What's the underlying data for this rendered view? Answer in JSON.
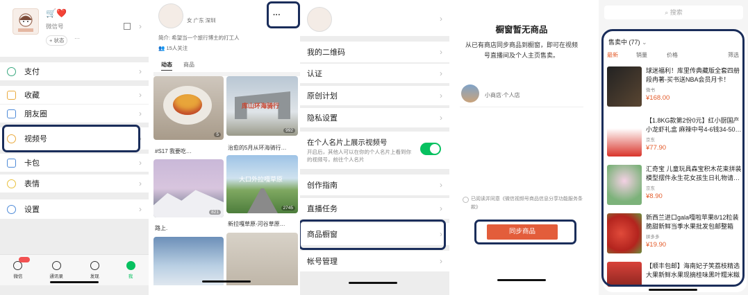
{
  "p1": {
    "nickname": "🛒❤️",
    "wechat_id": "微信号",
    "status": "+ 状态",
    "status_more": "···",
    "menu": [
      {
        "label": "支付"
      },
      {
        "label": "收藏"
      },
      {
        "label": "朋友圈"
      },
      {
        "label": "视频号"
      },
      {
        "label": "卡包"
      },
      {
        "label": "表情"
      },
      {
        "label": "设置"
      }
    ],
    "tabs": [
      "微信",
      "通讯录",
      "发现",
      "我"
    ]
  },
  "p2": {
    "more": "···",
    "profile_meta": "女 广东 深圳",
    "bio": "简介: 希望当一个旅行博主的打工人",
    "followers": "15人关注",
    "tabs": [
      "动态",
      "商品"
    ],
    "posts": [
      {
        "caption": "#S17 我要吃…",
        "views": "5"
      },
      {
        "caption": "治愈的5月从环海骑行…",
        "views": "992"
      },
      {
        "caption": "路上.",
        "views": "821"
      },
      {
        "caption": "新拉嘎草原-河谷草原…",
        "views": "2745"
      }
    ],
    "arch_text": "库山环海骑行",
    "road_text": "大口外拉嘎草原"
  },
  "p3": {
    "items": [
      {
        "label": "我的二维码"
      },
      {
        "label": "认证"
      },
      {
        "label": "原创计划"
      },
      {
        "label": "隐私设置"
      }
    ],
    "toggle_label": "在个人名片上展示视频号",
    "toggle_desc": "开启后，其他人可以在你的个人名片上看到你的视频号，前往个人名片",
    "items2": [
      {
        "label": "创作指南"
      },
      {
        "label": "直播任务"
      },
      {
        "label": "商品橱窗"
      },
      {
        "label": "帐号管理"
      }
    ]
  },
  "p4": {
    "title": "橱窗暂无商品",
    "desc": "从已有商店同步商品到橱窗，即可在视频号直播间及个人主页售卖。",
    "shop": "小商店·个人店",
    "agree": "已阅读并同意《微信视频号商品信息分享功能服务条款》",
    "sync_button": "同步商品"
  },
  "p5": {
    "search_placeholder": "搜索",
    "filter": "售卖中 (77)",
    "sorts": [
      "最新",
      "销量",
      "价格",
      "筛选"
    ],
    "products": [
      {
        "title": "球迷福利！库里传典藏版全套四册 段冉著-买书送NBA会员月卡！",
        "shop": "微书",
        "price": "¥168.00"
      },
      {
        "title": "【1.8KG款第2份0元】红小厨国产小龙虾礼盒 麻辣中号4-6钱34-50…",
        "shop": "京东",
        "price": "¥77.90"
      },
      {
        "title": "汇奇宝 儿童玩具森宝积木花束拼装模型摆件永生花女孩生日礼物请…",
        "shop": "京东",
        "price": "¥8.90"
      },
      {
        "title": "新西兰进口gala嘎啦苹果8/12粒装脆甜新鲜当季水果批发包邮整箱",
        "shop": "拼多多",
        "price": "¥19.90"
      },
      {
        "title": "【顺丰包邮】海南妃子笑荔枝精选大果新鲜水果现摘桂味黑叶糯米糍",
        "shop": "",
        "price": ""
      }
    ]
  }
}
